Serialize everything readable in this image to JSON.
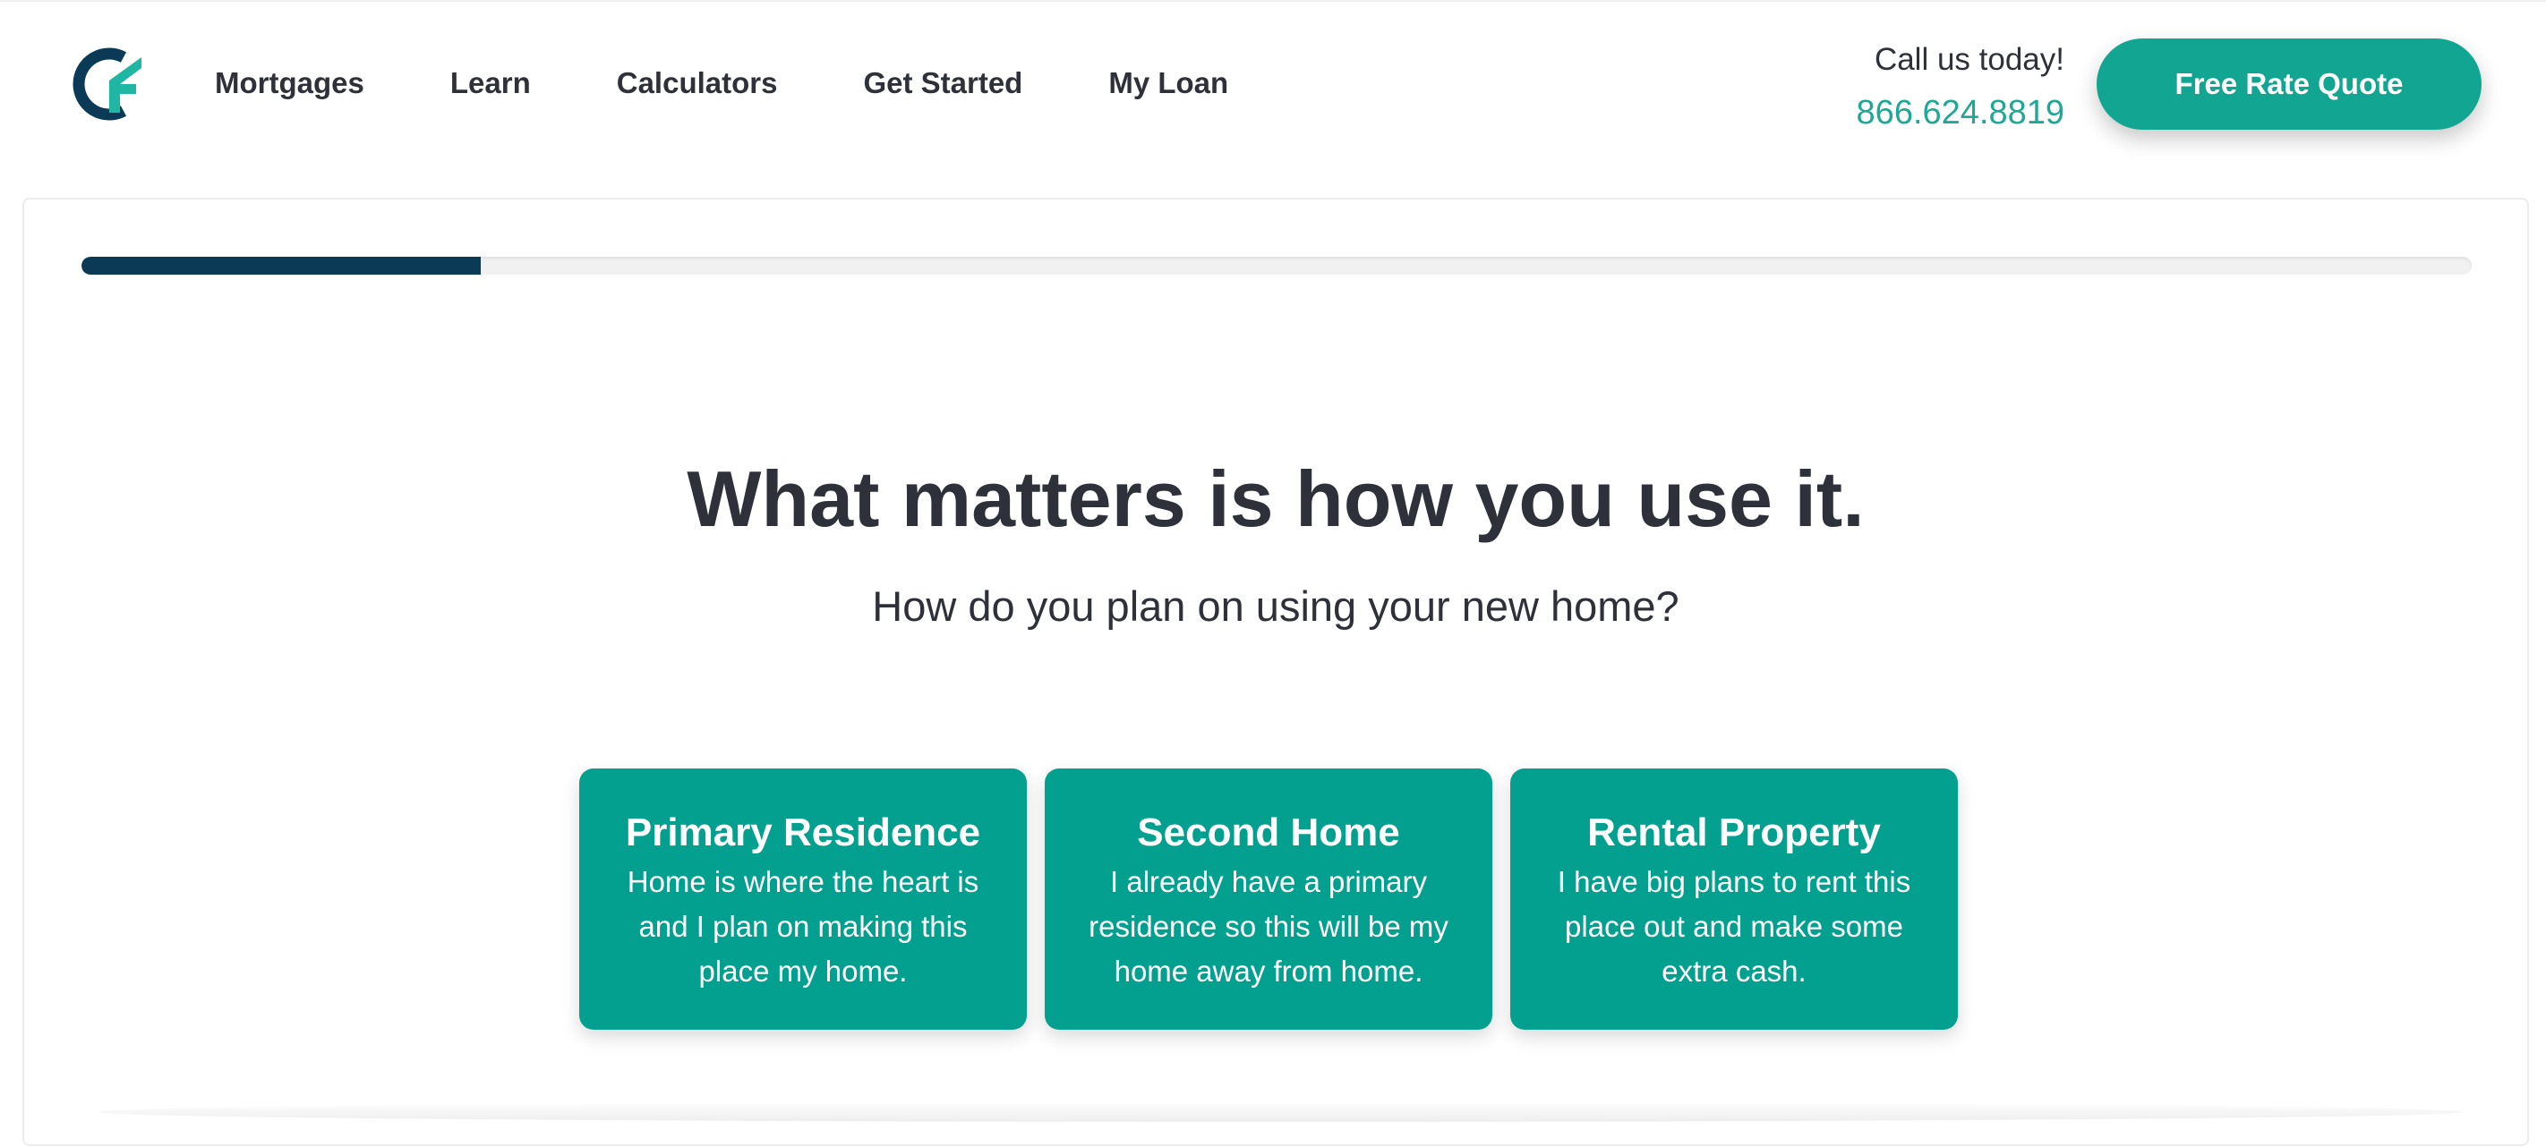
{
  "header": {
    "logo_icon": "company-cf-logo-icon",
    "nav": [
      {
        "label": "Mortgages"
      },
      {
        "label": "Learn"
      },
      {
        "label": "Calculators"
      },
      {
        "label": "Get Started"
      },
      {
        "label": "My Loan"
      }
    ],
    "call_label": "Call us today!",
    "phone": "866.624.8819",
    "quote_button": "Free Rate Quote"
  },
  "progress": {
    "value": 0.167
  },
  "main": {
    "title": "What matters is how you use it.",
    "subtitle": "How do you plan on using your new home?",
    "options": [
      {
        "title": "Primary Residence",
        "description": "Home is where the heart is and I plan on making this place my home."
      },
      {
        "title": "Second Home",
        "description": "I already have a primary residence so this will be my home away from home."
      },
      {
        "title": "Rental Property",
        "description": "I have big plans to rent this place out and make some extra cash."
      }
    ]
  },
  "colors": {
    "brand_teal": "#039f8f",
    "brand_navy": "#0b3a57",
    "phone_teal": "#1ea895",
    "text_dark": "#2e3139"
  }
}
